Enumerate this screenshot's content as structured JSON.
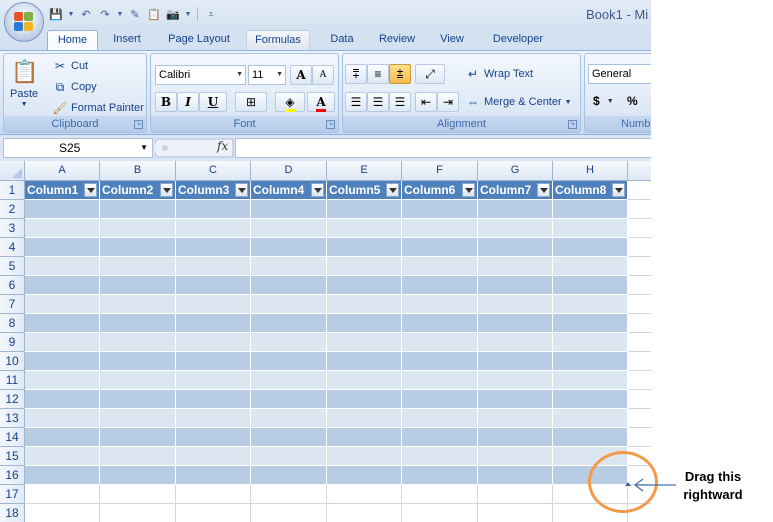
{
  "window": {
    "title": "Book1 - Mi"
  },
  "quick_access": {
    "items": [
      {
        "icon": "save-icon",
        "glyph": "💾"
      },
      {
        "icon": "undo-icon",
        "glyph": "↶"
      },
      {
        "icon": "redo-icon",
        "glyph": "↷"
      },
      {
        "icon": "edit-icon",
        "glyph": "✎"
      },
      {
        "icon": "paste-icon",
        "glyph": "📋"
      },
      {
        "icon": "camera-icon",
        "glyph": "📷"
      }
    ]
  },
  "tabs": [
    "Home",
    "Insert",
    "Page Layout",
    "Formulas",
    "Data",
    "Review",
    "View",
    "Developer"
  ],
  "active_tab": "Home",
  "ribbon": {
    "clipboard": {
      "label": "Clipboard",
      "paste": "Paste",
      "cut": "Cut",
      "copy": "Copy",
      "format_painter": "Format Painter"
    },
    "font": {
      "label": "Font",
      "family": "Calibri",
      "size": "11",
      "bold": "B",
      "italic": "I",
      "underline": "U",
      "grow": "A",
      "shrink": "A"
    },
    "alignment": {
      "label": "Alignment",
      "wrap_text": "Wrap Text",
      "merge_center": "Merge & Center"
    },
    "number": {
      "label": "Numb",
      "format": "General",
      "currency": "$",
      "percent": "%"
    }
  },
  "formula_bar": {
    "name_box": "S25",
    "fx": "fx",
    "formula": ""
  },
  "sheet": {
    "columns": [
      "A",
      "B",
      "C",
      "D",
      "E",
      "F",
      "G",
      "H"
    ],
    "rows": [
      "1",
      "2",
      "3",
      "4",
      "5",
      "6",
      "7",
      "8",
      "9",
      "10",
      "11",
      "12",
      "13",
      "14",
      "15",
      "16",
      "17",
      "18"
    ],
    "table_headers": [
      "Column1",
      "Column2",
      "Column3",
      "Column4",
      "Column5",
      "Column6",
      "Column7",
      "Column8"
    ],
    "table_last_row": 16,
    "colors": {
      "header": "#4f81bd",
      "band_dark": "#b8cce4",
      "band_light": "#dce6f1"
    }
  },
  "annotation": {
    "line1": "Drag this",
    "line2": "rightward",
    "color": "#f29a48"
  }
}
